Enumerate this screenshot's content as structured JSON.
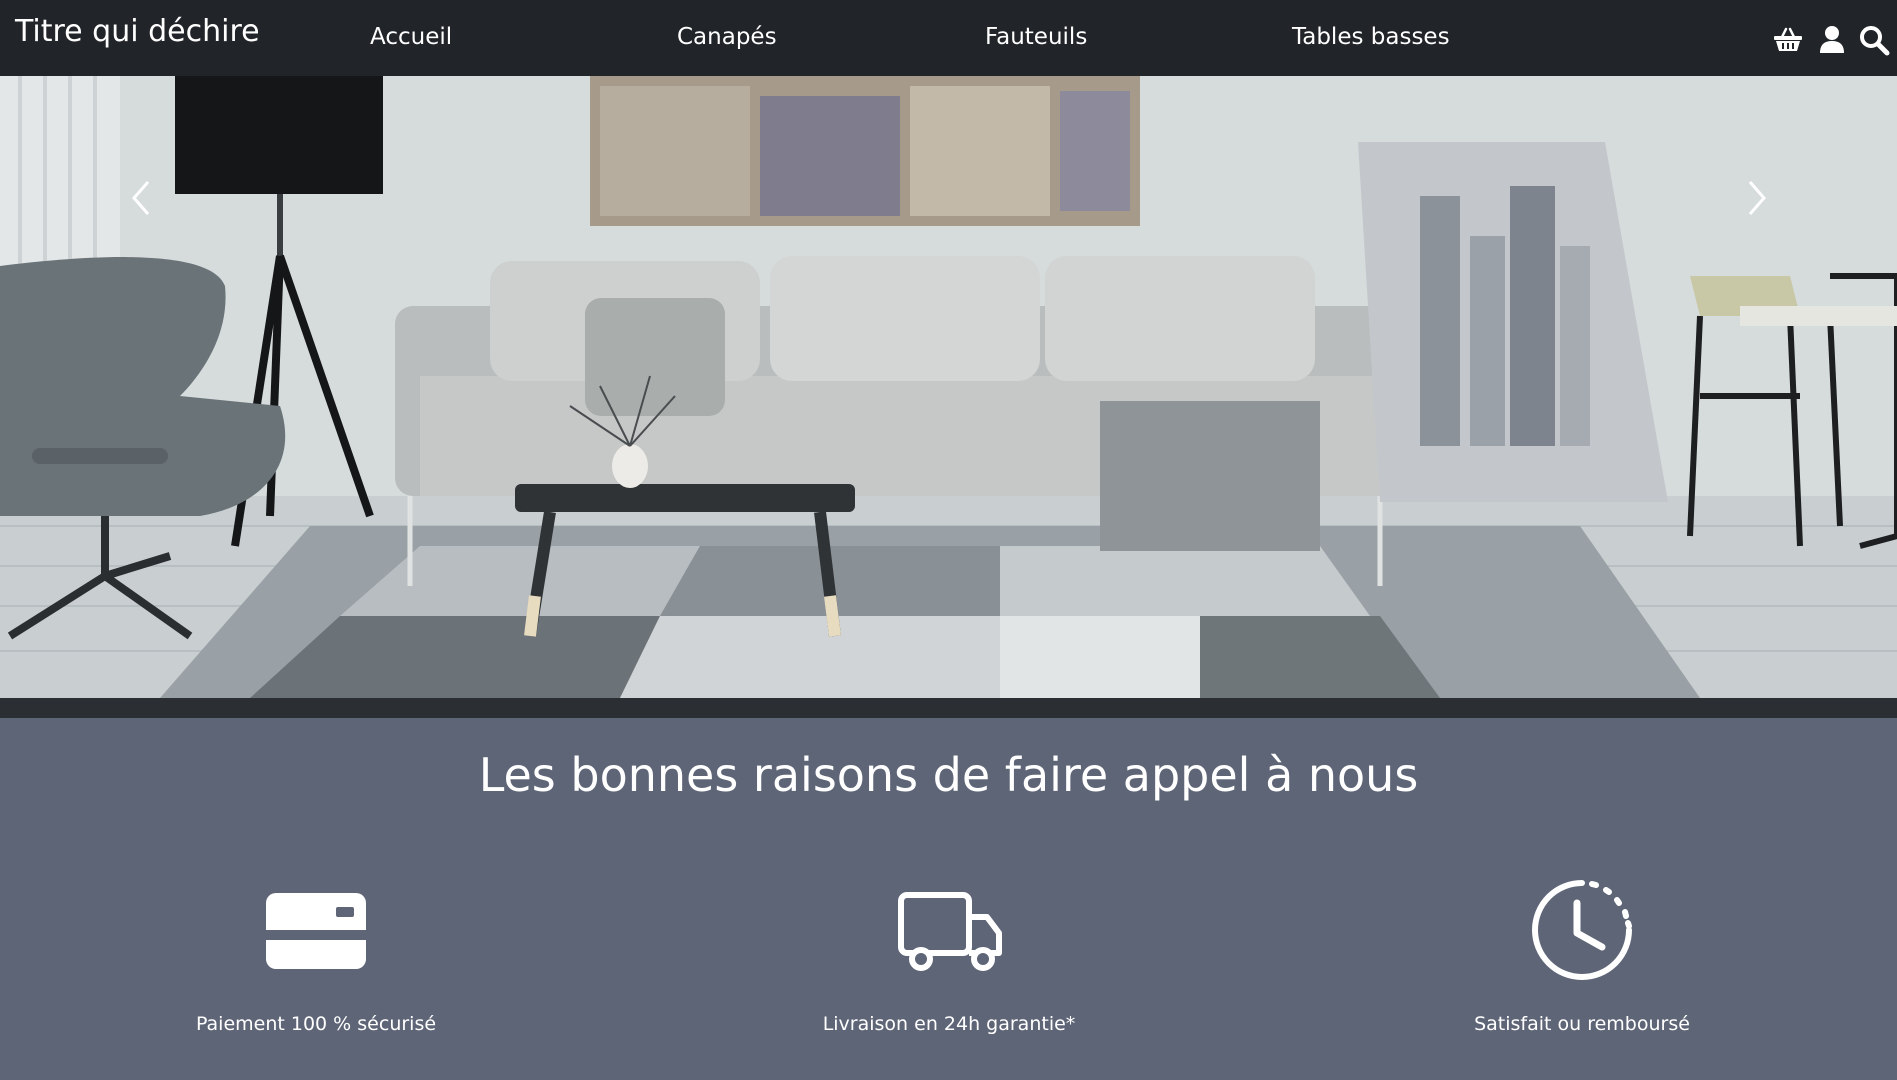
{
  "navbar": {
    "brand": "Titre qui déchire",
    "links": [
      {
        "label": "Accueil"
      },
      {
        "label": "Canapés"
      },
      {
        "label": "Fauteuils"
      },
      {
        "label": "Tables basses"
      }
    ],
    "icons": [
      "basket-icon",
      "user-icon",
      "search-icon"
    ]
  },
  "carousel": {
    "prev_icon": "chevron-left-icon",
    "next_icon": "chevron-right-icon"
  },
  "reasons": {
    "title": "Les bonnes raisons de faire appel à nous",
    "items": [
      {
        "icon": "credit-card-icon",
        "label": "Paiement 100 % sécurisé"
      },
      {
        "icon": "truck-icon",
        "label": "Livraison en 24h garantie*"
      },
      {
        "icon": "clock-icon",
        "label": "Satisfait ou remboursé"
      }
    ]
  },
  "colors": {
    "navbar_bg": "#212429",
    "section_bg": "#5e6577",
    "text": "#ffffff"
  }
}
